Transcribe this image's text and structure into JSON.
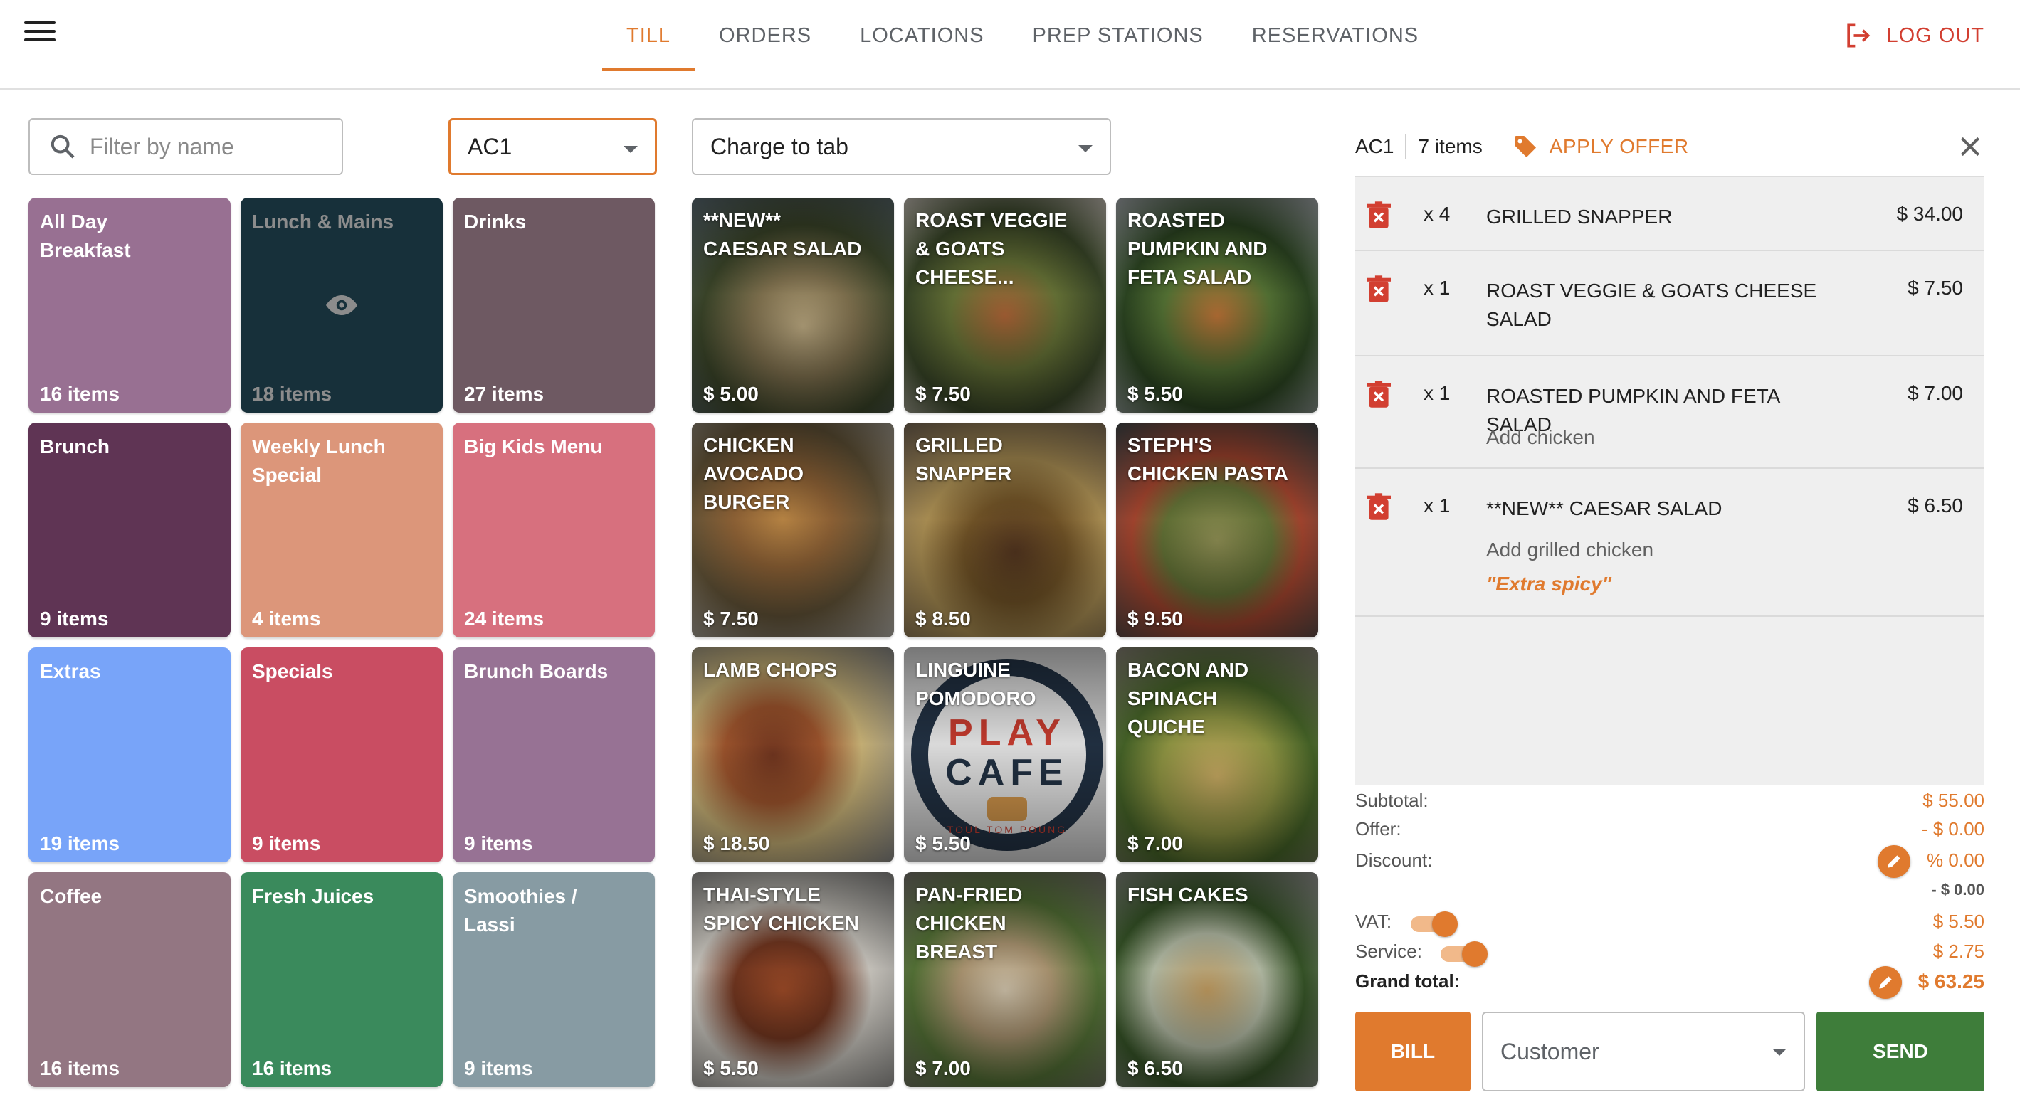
{
  "header": {
    "tabs": [
      {
        "label": "TILL",
        "active": true
      },
      {
        "label": "ORDERS",
        "active": false
      },
      {
        "label": "LOCATIONS",
        "active": false
      },
      {
        "label": "PREP STATIONS",
        "active": false
      },
      {
        "label": "RESERVATIONS",
        "active": false
      }
    ],
    "logout_label": "LOG OUT"
  },
  "controls": {
    "filter_placeholder": "Filter by name",
    "table_select": "AC1",
    "payment_select": "Charge to tab"
  },
  "categories": [
    {
      "name": "All Day Breakfast",
      "count": "16 items",
      "color": "#987092"
    },
    {
      "name": "Lunch & Mains",
      "count": "18 items",
      "color": "#17303a",
      "hidden": true
    },
    {
      "name": "Drinks",
      "count": "27 items",
      "color": "#6e5962"
    },
    {
      "name": "Brunch",
      "count": "9 items",
      "color": "#5f3454"
    },
    {
      "name": "Weekly Lunch Special",
      "count": "4 items",
      "color": "#dc967a"
    },
    {
      "name": "Big Kids Menu",
      "count": "24 items",
      "color": "#d7707e"
    },
    {
      "name": "Extras",
      "count": "19 items",
      "color": "#78a4f9"
    },
    {
      "name": "Specials",
      "count": "9 items",
      "color": "#c94d62"
    },
    {
      "name": "Brunch Boards",
      "count": "9 items",
      "color": "#977294"
    },
    {
      "name": "Coffee",
      "count": "16 items",
      "color": "#937682"
    },
    {
      "name": "Fresh Juices",
      "count": "16 items",
      "color": "#3a8a5c"
    },
    {
      "name": "Smoothies / Lassi",
      "count": "9 items",
      "color": "#879ba3"
    }
  ],
  "products": [
    {
      "name": "**NEW** CAESAR SALAD",
      "price": "$ 5.00",
      "bg": "radial-gradient(circle at 55% 60%, #c9b58a 0%, #8a7a55 30%, #3f4a2c 60%, #5e6e78 100%)"
    },
    {
      "name": "ROAST VEGGIE & GOATS CHEESE...",
      "price": "$ 7.50",
      "bg": "radial-gradient(circle at 50% 55%, #b76a3a 0%, #6d7a3a 35%, #3c4a2a 65%, #c8c2b8 100%)"
    },
    {
      "name": "ROASTED PUMPKIN AND FETA SALAD",
      "price": "$ 5.50",
      "bg": "radial-gradient(circle at 50% 55%, #c77a3a 0%, #5a7a38 35%, #2f4a24 60%, #a9aeb2 100%)"
    },
    {
      "name": "CHICKEN AVOCADO BURGER",
      "price": "$ 7.50",
      "bg": "radial-gradient(circle at 45% 45%, #c8904a 0%, #9a6a3a 30%, #6a5a3c 60%, #b8b4ac 100%)"
    },
    {
      "name": "GRILLED SNAPPER",
      "price": "$ 8.50",
      "bg": "radial-gradient(circle at 55% 60%, #5a3a22 0%, #7a5a2a 30%, #b89a5a 55%, #7a6a58 100%)"
    },
    {
      "name": "STEPH'S CHICKEN PASTA",
      "price": "$ 9.50",
      "bg": "radial-gradient(circle at 50% 55%, #9a9a5a 0%, #6a7a3a 35%, #b04a32 55%, #444a4c 100%)"
    },
    {
      "name": "LAMB CHOPS",
      "price": "$ 18.50",
      "bg": "radial-gradient(circle at 40% 50%, #7a3a22 0%, #a85a30 30%, #d8c080 55%, #8a8a88 100%)"
    },
    {
      "name": "LINGUINE POMODORO",
      "price": "$ 5.50",
      "logo": true
    },
    {
      "name": "BACON AND SPINACH QUICHE",
      "price": "$ 7.00",
      "bg": "radial-gradient(circle at 50% 60%, #d8b86a 0%, #9aa048 35%, #4a6a2a 60%, #8a8478 100%)"
    },
    {
      "name": "THAI-STYLE SPICY CHICKEN",
      "price": "$ 5.50",
      "bg": "radial-gradient(circle at 45% 55%, #a8502a 0%, #7a3a22 30%, #d8d4cc 55%, #8a8a88 100%)"
    },
    {
      "name": "PAN-FRIED CHICKEN BREAST",
      "price": "$ 7.00",
      "bg": "radial-gradient(circle at 50% 55%, #e0d2b8 0%, #b8a07a 30%, #5a7a3a 60%, #7a7670 100%)"
    },
    {
      "name": "FISH CAKES",
      "price": "$ 6.50",
      "bg": "radial-gradient(circle at 45% 55%, #d0a868 0%, #c0c8b0 35%, #3a5a2a 60%, #9a9a98 100%)"
    }
  ],
  "order": {
    "table": "AC1",
    "item_count": "7 items",
    "apply_offer_label": "APPLY OFFER",
    "lines": [
      {
        "qty": "x 4",
        "name": "GRILLED SNAPPER",
        "amount": "$ 34.00",
        "modifiers": [],
        "note": ""
      },
      {
        "qty": "x 1",
        "name": "ROAST VEGGIE & GOATS CHEESE SALAD",
        "amount": "$ 7.50",
        "modifiers": [],
        "note": ""
      },
      {
        "qty": "x 1",
        "name": "ROASTED PUMPKIN AND FETA SALAD",
        "amount": "$ 7.00",
        "modifiers": [
          "Add chicken"
        ],
        "note": ""
      },
      {
        "qty": "x 1",
        "name": "**NEW** CAESAR SALAD",
        "amount": "$ 6.50",
        "modifiers": [
          "Add grilled chicken"
        ],
        "note": "\"Extra spicy\""
      }
    ]
  },
  "totals": {
    "subtotal_label": "Subtotal:",
    "subtotal": "$ 55.00",
    "offer_label": "Offer:",
    "offer": "- $ 0.00",
    "discount_label": "Discount:",
    "discount_pct": "% 0.00",
    "discount_amount": "- $ 0.00",
    "vat_label": "VAT:",
    "vat": "$ 5.50",
    "vat_on": true,
    "service_label": "Service:",
    "service": "$ 2.75",
    "service_on": true,
    "grand_label": "Grand total:",
    "grand": "$ 63.25"
  },
  "actions": {
    "bill_label": "BILL",
    "customer_select": "Customer",
    "send_label": "SEND"
  },
  "colors": {
    "accent": "#e07a2e",
    "danger": "#d23f31",
    "send": "#3e7d3a"
  }
}
